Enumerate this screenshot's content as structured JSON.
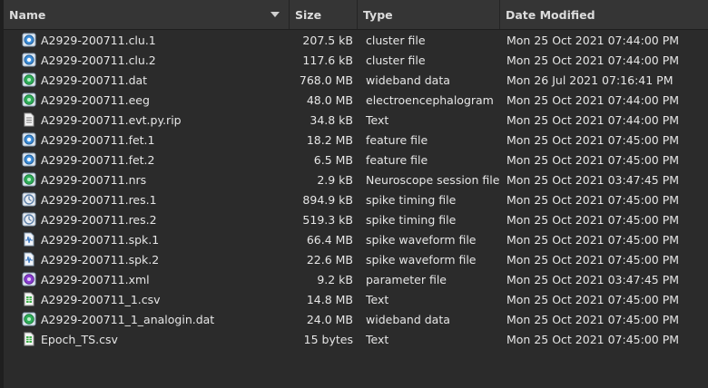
{
  "header": {
    "name": "Name",
    "size": "Size",
    "type": "Type",
    "date": "Date Modified"
  },
  "files": [
    {
      "name": "A2929-200711.clu.1",
      "size": "207.5 kB",
      "type": "cluster file",
      "date": "Mon 25 Oct 2021 07:44:00 PM",
      "icon": "blue-disc-icon"
    },
    {
      "name": "A2929-200711.clu.2",
      "size": "117.6 kB",
      "type": "cluster file",
      "date": "Mon 25 Oct 2021 07:44:00 PM",
      "icon": "blue-disc-icon"
    },
    {
      "name": "A2929-200711.dat",
      "size": "768.0 MB",
      "type": "wideband data",
      "date": "Mon 26 Jul 2021 07:16:41 PM",
      "icon": "green-disc-icon"
    },
    {
      "name": "A2929-200711.eeg",
      "size": "48.0 MB",
      "type": "electroencephalogram",
      "date": "Mon 25 Oct 2021 07:44:00 PM",
      "icon": "green-disc-icon"
    },
    {
      "name": "A2929-200711.evt.py.rip",
      "size": "34.8 kB",
      "type": "Text",
      "date": "Mon 25 Oct 2021 07:44:00 PM",
      "icon": "text-file-icon"
    },
    {
      "name": "A2929-200711.fet.1",
      "size": "18.2 MB",
      "type": "feature file",
      "date": "Mon 25 Oct 2021 07:45:00 PM",
      "icon": "blue-disc-icon"
    },
    {
      "name": "A2929-200711.fet.2",
      "size": "6.5 MB",
      "type": "feature file",
      "date": "Mon 25 Oct 2021 07:45:00 PM",
      "icon": "blue-disc-icon"
    },
    {
      "name": "A2929-200711.nrs",
      "size": "2.9 kB",
      "type": "Neuroscope session file",
      "date": "Mon 25 Oct 2021 03:47:45 PM",
      "icon": "green-disc-icon"
    },
    {
      "name": "A2929-200711.res.1",
      "size": "894.9 kB",
      "type": "spike timing file",
      "date": "Mon 25 Oct 2021 07:45:00 PM",
      "icon": "spike-timing-icon"
    },
    {
      "name": "A2929-200711.res.2",
      "size": "519.3 kB",
      "type": "spike timing file",
      "date": "Mon 25 Oct 2021 07:45:00 PM",
      "icon": "spike-timing-icon"
    },
    {
      "name": "A2929-200711.spk.1",
      "size": "66.4 MB",
      "type": "spike waveform file",
      "date": "Mon 25 Oct 2021 07:45:00 PM",
      "icon": "waveform-file-icon"
    },
    {
      "name": "A2929-200711.spk.2",
      "size": "22.6 MB",
      "type": "spike waveform file",
      "date": "Mon 25 Oct 2021 07:45:00 PM",
      "icon": "waveform-file-icon"
    },
    {
      "name": "A2929-200711.xml",
      "size": "9.2 kB",
      "type": "parameter file",
      "date": "Mon 25 Oct 2021 03:47:45 PM",
      "icon": "purple-disc-icon"
    },
    {
      "name": "A2929-200711_1.csv",
      "size": "14.8 MB",
      "type": "Text",
      "date": "Mon 25 Oct 2021 07:45:00 PM",
      "icon": "spreadsheet-icon"
    },
    {
      "name": "A2929-200711_1_analogin.dat",
      "size": "24.0 MB",
      "type": "wideband data",
      "date": "Mon 25 Oct 2021 07:45:00 PM",
      "icon": "green-disc-icon"
    },
    {
      "name": "Epoch_TS.csv",
      "size": "15 bytes",
      "type": "Text",
      "date": "Mon 25 Oct 2021 07:45:00 PM",
      "icon": "spreadsheet-icon"
    }
  ]
}
